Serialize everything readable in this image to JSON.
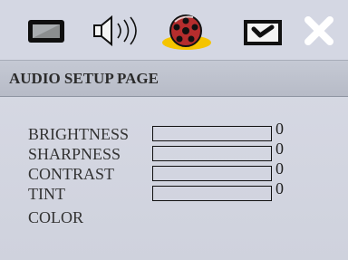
{
  "header": {
    "title": "AUDIO SETUP PAGE"
  },
  "toolbar": {
    "tools": [
      {
        "name": "display-icon"
      },
      {
        "name": "speaker-icon"
      },
      {
        "name": "video-reel-icon"
      },
      {
        "name": "check-icon"
      },
      {
        "name": "close-icon"
      }
    ]
  },
  "settings": [
    {
      "label": "BRIGHTNESS",
      "value": "0",
      "level": 0
    },
    {
      "label": "SHARPNESS",
      "value": "0",
      "level": 0
    },
    {
      "label": "CONTRAST",
      "value": "0",
      "level": 0
    },
    {
      "label": "TINT",
      "value": "0",
      "level": 0
    },
    {
      "label": "COLOR"
    }
  ],
  "colors": {
    "background": "#d4d7e3",
    "header": "#bdc1cc",
    "text": "#333333",
    "highlight": "#f5c400",
    "reel": "#b52d2d"
  }
}
